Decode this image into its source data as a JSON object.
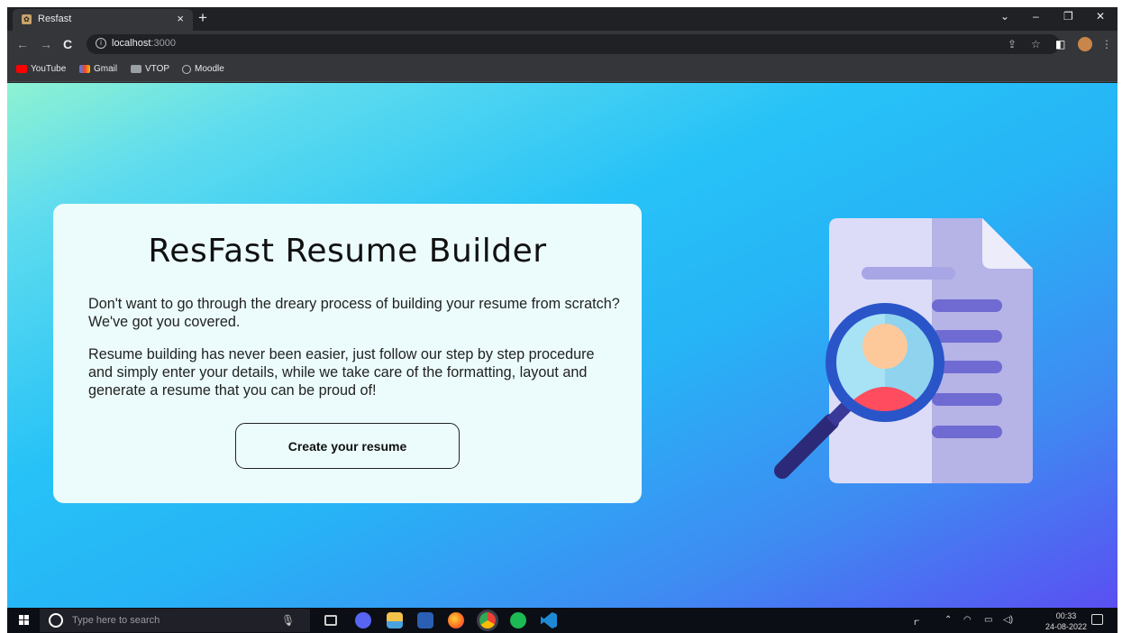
{
  "browser": {
    "tab": {
      "title": "Resfast",
      "close_glyph": "×"
    },
    "new_tab_glyph": "+",
    "window_controls": {
      "dropdown": "⌄",
      "minimize": "–",
      "restore": "❐",
      "close": "✕"
    },
    "nav": {
      "back": "←",
      "forward": "→",
      "reload": "C"
    },
    "address": {
      "host": "localhost",
      "port": ":3000"
    },
    "bookmarks": [
      "YouTube",
      "Gmail",
      "VTOP",
      "Moodle"
    ]
  },
  "page": {
    "title": "ResFast Resume Builder",
    "intro": "Don't want to go through the dreary process of building your resume from scratch? We've got you covered.",
    "description": "Resume building has never been easier, just follow our step by step procedure and simply enter your details, while we take care of the formatting, layout and generate a resume that you can be proud of!",
    "cta_label": "Create your resume",
    "illustration_icon": "document-magnifier-icon"
  },
  "taskbar": {
    "search_placeholder": "Type here to search",
    "time": "00:33",
    "date": "24-08-2022",
    "apps": [
      "task-view-icon",
      "discord-icon",
      "file-explorer-icon",
      "word-icon",
      "firefox-icon",
      "chrome-icon",
      "spotify-icon",
      "vscode-icon"
    ]
  },
  "colors": {
    "page_gradient": [
      "#8ff2d2",
      "#27c2f7",
      "#3e8cf2",
      "#5a4ff2"
    ],
    "card_bg": "#ecfcfc"
  }
}
